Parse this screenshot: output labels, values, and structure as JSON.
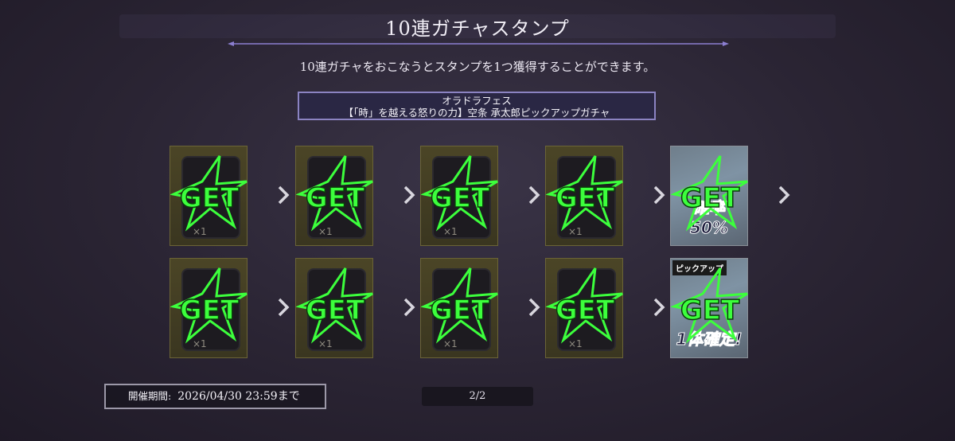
{
  "header": {
    "title": "10連ガチャスタンプ",
    "description": "10連ガチャをおこなうとスタンプを1つ獲得することができます。"
  },
  "banner": {
    "line1": "オラドラフェス",
    "line2": "【「時」を越える怒りの力】空条 承太郎ピックアップガチャ"
  },
  "stamps": {
    "get_label": "GET",
    "quantity_label": "×1",
    "row1_special_text": "確率50%",
    "row2_special_text": "1体確定!",
    "row2_special_tag": "ピックアップ"
  },
  "footer": {
    "period_label": "開催期間:",
    "period_value": "2026/04/30 23:59まで",
    "page_indicator": "2/2"
  },
  "colors": {
    "get_green": "#3cff3c",
    "stamp_bg": "#4b4526",
    "banner_border": "#8b83c2"
  }
}
